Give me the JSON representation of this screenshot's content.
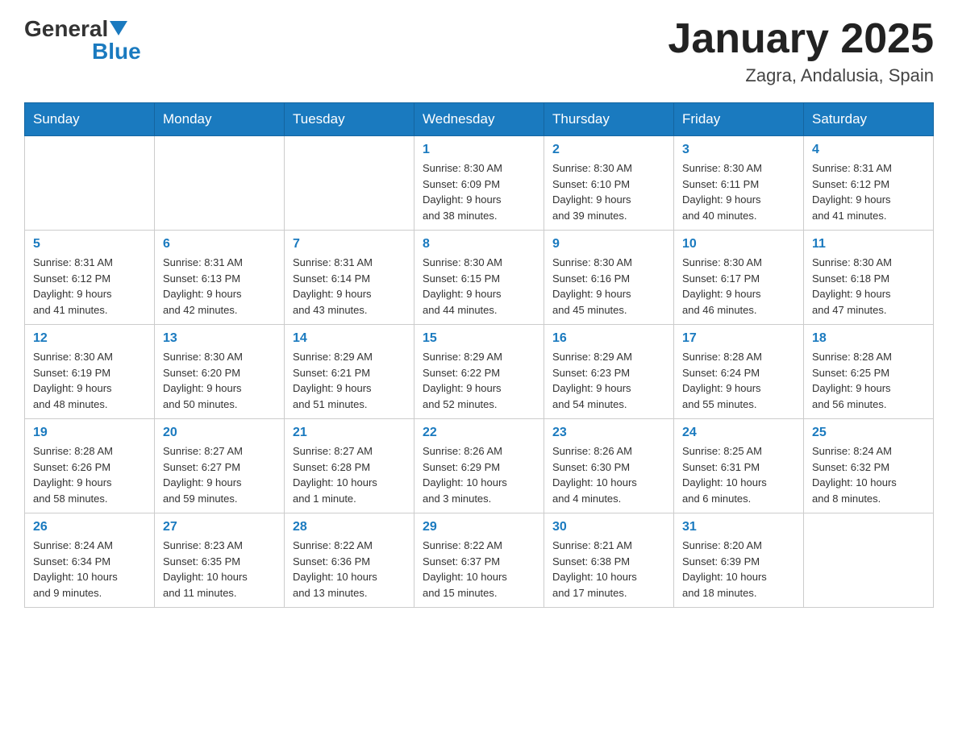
{
  "header": {
    "logo": {
      "general": "General",
      "blue": "Blue",
      "arrow_color": "#1a7abf"
    },
    "title": "January 2025",
    "location": "Zagra, Andalusia, Spain"
  },
  "calendar": {
    "days_of_week": [
      "Sunday",
      "Monday",
      "Tuesday",
      "Wednesday",
      "Thursday",
      "Friday",
      "Saturday"
    ],
    "weeks": [
      [
        {
          "day": "",
          "info": ""
        },
        {
          "day": "",
          "info": ""
        },
        {
          "day": "",
          "info": ""
        },
        {
          "day": "1",
          "info": "Sunrise: 8:30 AM\nSunset: 6:09 PM\nDaylight: 9 hours\nand 38 minutes."
        },
        {
          "day": "2",
          "info": "Sunrise: 8:30 AM\nSunset: 6:10 PM\nDaylight: 9 hours\nand 39 minutes."
        },
        {
          "day": "3",
          "info": "Sunrise: 8:30 AM\nSunset: 6:11 PM\nDaylight: 9 hours\nand 40 minutes."
        },
        {
          "day": "4",
          "info": "Sunrise: 8:31 AM\nSunset: 6:12 PM\nDaylight: 9 hours\nand 41 minutes."
        }
      ],
      [
        {
          "day": "5",
          "info": "Sunrise: 8:31 AM\nSunset: 6:12 PM\nDaylight: 9 hours\nand 41 minutes."
        },
        {
          "day": "6",
          "info": "Sunrise: 8:31 AM\nSunset: 6:13 PM\nDaylight: 9 hours\nand 42 minutes."
        },
        {
          "day": "7",
          "info": "Sunrise: 8:31 AM\nSunset: 6:14 PM\nDaylight: 9 hours\nand 43 minutes."
        },
        {
          "day": "8",
          "info": "Sunrise: 8:30 AM\nSunset: 6:15 PM\nDaylight: 9 hours\nand 44 minutes."
        },
        {
          "day": "9",
          "info": "Sunrise: 8:30 AM\nSunset: 6:16 PM\nDaylight: 9 hours\nand 45 minutes."
        },
        {
          "day": "10",
          "info": "Sunrise: 8:30 AM\nSunset: 6:17 PM\nDaylight: 9 hours\nand 46 minutes."
        },
        {
          "day": "11",
          "info": "Sunrise: 8:30 AM\nSunset: 6:18 PM\nDaylight: 9 hours\nand 47 minutes."
        }
      ],
      [
        {
          "day": "12",
          "info": "Sunrise: 8:30 AM\nSunset: 6:19 PM\nDaylight: 9 hours\nand 48 minutes."
        },
        {
          "day": "13",
          "info": "Sunrise: 8:30 AM\nSunset: 6:20 PM\nDaylight: 9 hours\nand 50 minutes."
        },
        {
          "day": "14",
          "info": "Sunrise: 8:29 AM\nSunset: 6:21 PM\nDaylight: 9 hours\nand 51 minutes."
        },
        {
          "day": "15",
          "info": "Sunrise: 8:29 AM\nSunset: 6:22 PM\nDaylight: 9 hours\nand 52 minutes."
        },
        {
          "day": "16",
          "info": "Sunrise: 8:29 AM\nSunset: 6:23 PM\nDaylight: 9 hours\nand 54 minutes."
        },
        {
          "day": "17",
          "info": "Sunrise: 8:28 AM\nSunset: 6:24 PM\nDaylight: 9 hours\nand 55 minutes."
        },
        {
          "day": "18",
          "info": "Sunrise: 8:28 AM\nSunset: 6:25 PM\nDaylight: 9 hours\nand 56 minutes."
        }
      ],
      [
        {
          "day": "19",
          "info": "Sunrise: 8:28 AM\nSunset: 6:26 PM\nDaylight: 9 hours\nand 58 minutes."
        },
        {
          "day": "20",
          "info": "Sunrise: 8:27 AM\nSunset: 6:27 PM\nDaylight: 9 hours\nand 59 minutes."
        },
        {
          "day": "21",
          "info": "Sunrise: 8:27 AM\nSunset: 6:28 PM\nDaylight: 10 hours\nand 1 minute."
        },
        {
          "day": "22",
          "info": "Sunrise: 8:26 AM\nSunset: 6:29 PM\nDaylight: 10 hours\nand 3 minutes."
        },
        {
          "day": "23",
          "info": "Sunrise: 8:26 AM\nSunset: 6:30 PM\nDaylight: 10 hours\nand 4 minutes."
        },
        {
          "day": "24",
          "info": "Sunrise: 8:25 AM\nSunset: 6:31 PM\nDaylight: 10 hours\nand 6 minutes."
        },
        {
          "day": "25",
          "info": "Sunrise: 8:24 AM\nSunset: 6:32 PM\nDaylight: 10 hours\nand 8 minutes."
        }
      ],
      [
        {
          "day": "26",
          "info": "Sunrise: 8:24 AM\nSunset: 6:34 PM\nDaylight: 10 hours\nand 9 minutes."
        },
        {
          "day": "27",
          "info": "Sunrise: 8:23 AM\nSunset: 6:35 PM\nDaylight: 10 hours\nand 11 minutes."
        },
        {
          "day": "28",
          "info": "Sunrise: 8:22 AM\nSunset: 6:36 PM\nDaylight: 10 hours\nand 13 minutes."
        },
        {
          "day": "29",
          "info": "Sunrise: 8:22 AM\nSunset: 6:37 PM\nDaylight: 10 hours\nand 15 minutes."
        },
        {
          "day": "30",
          "info": "Sunrise: 8:21 AM\nSunset: 6:38 PM\nDaylight: 10 hours\nand 17 minutes."
        },
        {
          "day": "31",
          "info": "Sunrise: 8:20 AM\nSunset: 6:39 PM\nDaylight: 10 hours\nand 18 minutes."
        },
        {
          "day": "",
          "info": ""
        }
      ]
    ]
  }
}
